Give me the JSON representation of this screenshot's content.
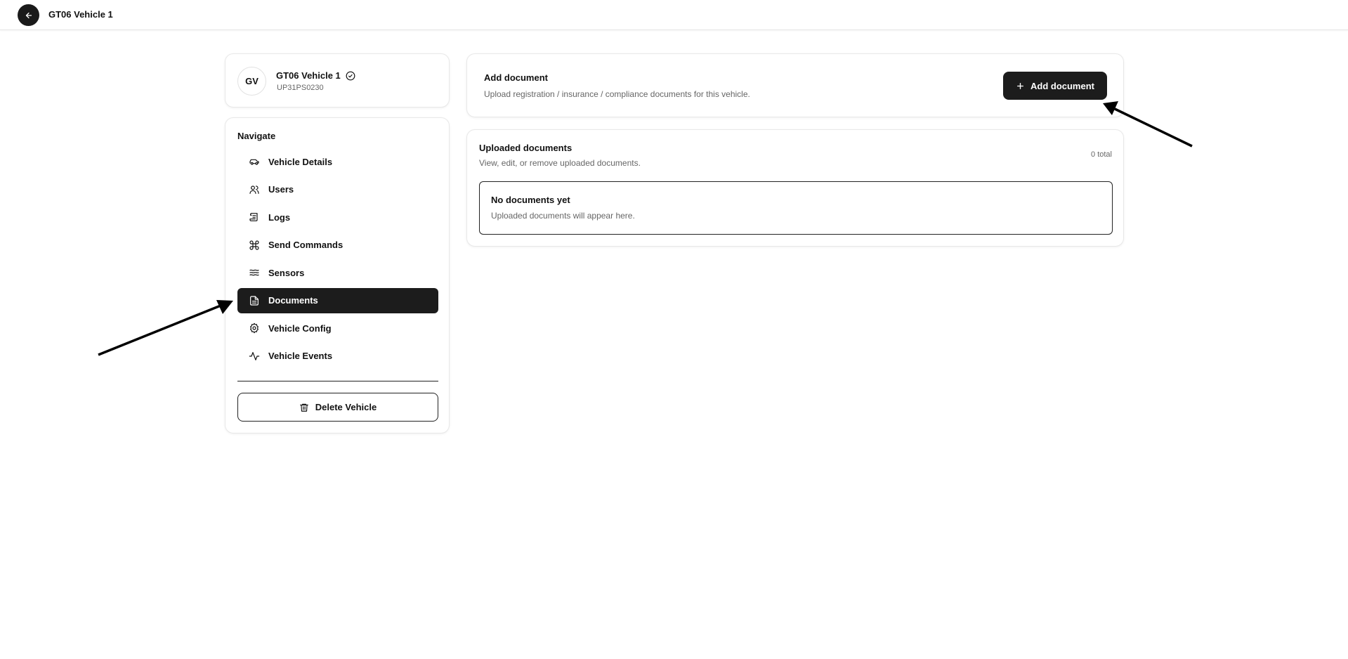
{
  "topbar": {
    "title": "GT06 Vehicle 1",
    "back_icon": "arrow-left-icon"
  },
  "vehicle": {
    "avatar_initials": "GV",
    "name": "GT06 Vehicle 1",
    "plate": "UP31PS0230",
    "verified_icon": "check-circle-icon"
  },
  "nav": {
    "title": "Navigate",
    "items": [
      {
        "label": "Vehicle Details",
        "icon": "car-icon",
        "active": false
      },
      {
        "label": "Users",
        "icon": "users-icon",
        "active": false
      },
      {
        "label": "Logs",
        "icon": "scroll-icon",
        "active": false
      },
      {
        "label": "Send Commands",
        "icon": "command-icon",
        "active": false
      },
      {
        "label": "Sensors",
        "icon": "waves-icon",
        "active": false
      },
      {
        "label": "Documents",
        "icon": "document-icon",
        "active": true
      },
      {
        "label": "Vehicle Config",
        "icon": "gear-icon",
        "active": false
      },
      {
        "label": "Vehicle Events",
        "icon": "activity-icon",
        "active": false
      }
    ],
    "delete_label": "Delete Vehicle",
    "delete_icon": "trash-icon"
  },
  "add_document": {
    "title": "Add document",
    "description": "Upload registration / insurance / compliance documents for this vehicle.",
    "button_label": "Add document",
    "button_icon": "plus-icon"
  },
  "uploaded": {
    "title": "Uploaded documents",
    "description": "View, edit, or remove uploaded documents.",
    "count": "0 total",
    "empty_title": "No documents yet",
    "empty_description": "Uploaded documents will appear here."
  },
  "colors": {
    "dark": "#1c1c1c",
    "muted_text": "#666666",
    "border": "#e8e8e8"
  }
}
